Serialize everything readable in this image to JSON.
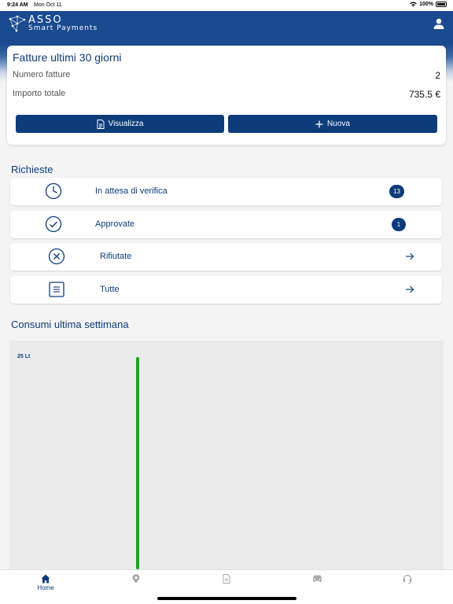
{
  "status_bar": {
    "time": "9:24 AM",
    "date": "Mon Oct 11",
    "battery": "100%"
  },
  "header": {
    "logo_title": "ASSO",
    "logo_subtitle": "Smart Payments",
    "user_icon": "user-icon"
  },
  "invoices": {
    "title": "Fatture ultimi 30 giorni",
    "count_label": "Numero fatture",
    "count_value": "2",
    "total_label": "Importo totale",
    "total_value": "735.5 €",
    "view_button": "Visualizza",
    "new_button": "Nuova"
  },
  "requests": {
    "title": "Richieste",
    "items": [
      {
        "label": "In attesa di verifica",
        "badge": "13",
        "icon": "clock-icon"
      },
      {
        "label": "Approvate",
        "badge": "1",
        "icon": "check-circle-icon"
      },
      {
        "label": "Rifiutate",
        "icon": "x-circle-icon"
      },
      {
        "label": "Tutte",
        "icon": "list-icon"
      }
    ]
  },
  "consumption": {
    "title": "Consumi ultima settimana"
  },
  "chart_data": {
    "type": "bar",
    "ylabel": "25 Lt",
    "series": [
      {
        "values": [
          25
        ],
        "color": "#1fa51f"
      }
    ],
    "ylim": [
      0,
      25
    ]
  },
  "tab_bar": {
    "tabs": [
      {
        "label": "Home",
        "icon": "home-icon",
        "active": true
      },
      {
        "label": "",
        "icon": "map-pin-icon"
      },
      {
        "label": "",
        "icon": "document-icon"
      },
      {
        "label": "",
        "icon": "car-icon"
      },
      {
        "label": "",
        "icon": "headset-icon"
      }
    ]
  },
  "colors": {
    "primary": "#0d3c7a",
    "header": "#1a4a8f",
    "chart_bar": "#1fa51f"
  }
}
